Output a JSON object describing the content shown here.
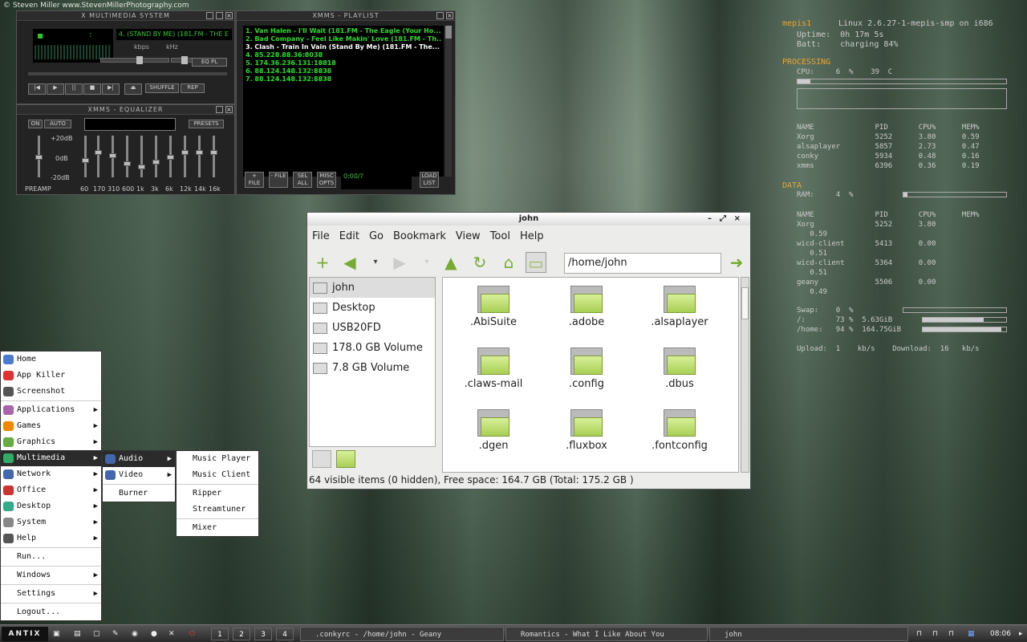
{
  "credit": "© Steven Miller www.StevenMillerPhotography.com",
  "xmms": {
    "main_title": "X MULTIMEDIA SYSTEM",
    "track": "4. (STAND BY ME) (181.FM - THE E",
    "kbps": "kbps",
    "khz": "kHz",
    "eqpl": "EQ PL",
    "shuffle": "SHUFFLE",
    "rep": "REP",
    "eq_title": "XMMS - EQUALIZER",
    "on": "ON",
    "auto": "AUTO",
    "presets": "PRESETS",
    "db_top": "+20dB",
    "db_mid": "0dB",
    "db_bot": "-20dB",
    "preamp": "PREAMP",
    "bands": [
      "60",
      "170",
      "310",
      "600",
      "1k",
      "3k",
      "6k",
      "12k",
      "14k",
      "16k"
    ],
    "pl_title": "XMMS - PLAYLIST",
    "playlist": [
      "1. Van Halen - I'll Wait (181.FM - The Eagle (Your Ho...",
      "2. Bad Company - Feel Like Makin' Love (181.FM - Th...",
      "3. Clash - Train In Vain (Stand By Me) (181.FM - The...",
      "4. 85.228.88.36:8038",
      "5. 174.36.236.131:18818",
      "6. 88.124.148.132:8838",
      "7. 88.124.148.132:8838"
    ],
    "time": "0:00/?",
    "pl_buttons": [
      "+ FILE",
      "- FILE",
      "SEL ALL",
      "MISC OPTS",
      "LOAD LIST"
    ]
  },
  "conky": {
    "host": "mepis1",
    "kernel": "Linux 2.6.27-1-mepis-smp on i686",
    "uptime": "Uptime:  0h 17m 5s",
    "batt": "Batt:    charging 84%",
    "processing": "PROCESSING",
    "cpu": "CPU:     6  %    39  C",
    "proc_header": "NAME              PID       CPU%      MEM%",
    "procs": [
      "Xorg              5252      3.80      0.59",
      "alsaplayer        5857      2.73      0.47",
      "conky             5934      0.48      0.16",
      "xmms              6396      0.36      0.19"
    ],
    "data": "DATA",
    "ram": "RAM:     4  %",
    "mem_header": "NAME              PID       CPU%      MEM%",
    "mems": [
      "Xorg              5252      3.80",
      "   0.59",
      "wicd-client       5413      0.00",
      "   0.51",
      "wicd-client       5364      0.00",
      "   0.51",
      "geany             5506      0.00",
      "   0.49"
    ],
    "swap": "Swap:    0  %",
    "root": "/:       73 %  5.63GiB",
    "home": "/home:   94 %  164.75GiB",
    "net": "Upload:  1    kb/s    Download:  16   kb/s",
    "cpu_pct": 6,
    "ram_pct": 4,
    "swap_pct": 0,
    "root_pct": 73,
    "home_pct": 94
  },
  "fm": {
    "title": "john",
    "menu": [
      "File",
      "Edit",
      "Go",
      "Bookmark",
      "View",
      "Tool",
      "Help"
    ],
    "path": "/home/john",
    "sidebar": [
      "john",
      "Desktop",
      "USB20FD",
      "178.0 GB Volume",
      "7.8 GB Volume"
    ],
    "files": [
      ".AbiSuite",
      ".adobe",
      ".alsaplayer",
      ".claws-mail",
      ".config",
      ".dbus",
      ".dgen",
      ".fluxbox",
      ".fontconfig"
    ],
    "status": "64 visible items (0 hidden), Free space: 164.7 GB (Total: 175.2 GB )"
  },
  "menu": {
    "items": [
      "Home",
      "App Killer",
      "Screenshot",
      "Applications",
      "Games",
      "Graphics",
      "Multimedia",
      "Network",
      "Office",
      "Desktop",
      "System",
      "Help",
      "Run...",
      "Windows",
      "Settings",
      "Logout..."
    ],
    "sub1": [
      "Audio",
      "Video",
      "Burner"
    ],
    "sub2": [
      "Music Player",
      "Music Client",
      "Ripper",
      "Streamtuner",
      "Mixer"
    ]
  },
  "taskbar": {
    "logo": "ANTIX",
    "desks": [
      "1",
      "2",
      "3",
      "4"
    ],
    "windows": [
      ".conkyrc - /home/john - Geany",
      "Romantics - What I Like About You",
      "john"
    ],
    "clock": "08:06"
  }
}
